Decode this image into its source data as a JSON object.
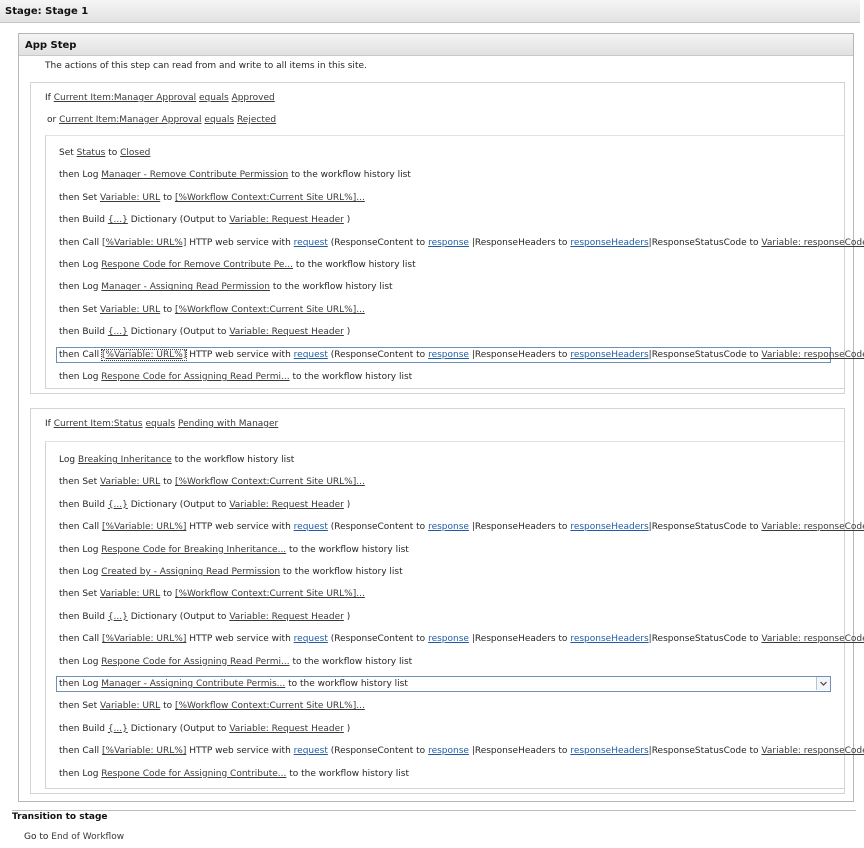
{
  "stage": {
    "title": "Stage: Stage 1"
  },
  "step": {
    "title": "App Step",
    "description": "The actions of this step can read from and write to all items in this site."
  },
  "block1": {
    "conditions": [
      {
        "prefix": "If",
        "field": "Current Item:Manager Approval",
        "op": "equals",
        "value": "Approved"
      },
      {
        "prefix": "or",
        "field": "Current Item:Manager Approval",
        "op": "equals",
        "value": "Rejected"
      }
    ],
    "actions": [
      {
        "prefix": "Set",
        "a": "Status",
        "mid": "to",
        "b": "Closed",
        "suffix": ""
      },
      {
        "prefix": "then Log",
        "a": "Manager - Remove Contribute Permission",
        "mid": "",
        "b": "",
        "suffix": "to the workflow history list"
      },
      {
        "prefix": "then Set",
        "a": "Variable: URL",
        "mid": "to",
        "b": "[%Workflow Context:Current Site URL%]...",
        "suffix": ""
      },
      {
        "prefix": "then Build",
        "a": "{...}",
        "mid": "Dictionary (Output to",
        "b": "Variable: Request Header",
        "suffix": ")"
      },
      {
        "prefix": "then Call",
        "http": true
      },
      {
        "prefix": "then Log",
        "a": "Respone Code for Remove Contribute Pe...",
        "mid": "",
        "b": "",
        "suffix": "to the workflow history list"
      },
      {
        "prefix": "then Log",
        "a": "Manager - Assigning Read Permission",
        "mid": "",
        "b": "",
        "suffix": "to the workflow history list"
      },
      {
        "prefix": "then Set",
        "a": "Variable: URL",
        "mid": "to",
        "b": "[%Workflow Context:Current Site URL%]...",
        "suffix": ""
      },
      {
        "prefix": "then Build",
        "a": "{...}",
        "mid": "Dictionary (Output to",
        "b": "Variable: Request Header",
        "suffix": ")"
      },
      {
        "prefix": "then Call",
        "http": true,
        "selected": true
      },
      {
        "prefix": "then Log",
        "a": "Respone Code for Assigning Read Permi...",
        "mid": "",
        "b": "",
        "suffix": "to the workflow history list"
      }
    ]
  },
  "block2": {
    "conditions": [
      {
        "prefix": "If",
        "field": "Current Item:Status",
        "op": "equals",
        "value": "Pending with Manager"
      }
    ],
    "actions": [
      {
        "prefix": "Log",
        "a": "Breaking Inheritance",
        "mid": "",
        "b": "",
        "suffix": "to the workflow history list"
      },
      {
        "prefix": "then Set",
        "a": "Variable: URL",
        "mid": "to",
        "b": "[%Workflow Context:Current Site URL%]...",
        "suffix": ""
      },
      {
        "prefix": "then Build",
        "a": "{...}",
        "mid": "Dictionary (Output to",
        "b": "Variable: Request Header",
        "suffix": ")"
      },
      {
        "prefix": "then Call",
        "http": true
      },
      {
        "prefix": "then Log",
        "a": "Respone Code for Breaking Inheritance...",
        "mid": "",
        "b": "",
        "suffix": "to the workflow history list"
      },
      {
        "prefix": "then Log",
        "a": "Created by - Assigning Read Permission",
        "mid": "",
        "b": "",
        "suffix": "to the workflow history list"
      },
      {
        "prefix": "then Set",
        "a": "Variable: URL",
        "mid": "to",
        "b": "[%Workflow Context:Current Site URL%]...",
        "suffix": ""
      },
      {
        "prefix": "then Build",
        "a": "{...}",
        "mid": "Dictionary (Output to",
        "b": "Variable: Request Header",
        "suffix": ")"
      },
      {
        "prefix": "then Call",
        "http": true
      },
      {
        "prefix": "then Log",
        "a": "Respone Code for Assigning Read Permi...",
        "mid": "",
        "b": "",
        "suffix": "to the workflow history list"
      },
      {
        "prefix": "then Log",
        "a": "Manager - Assigning Contribute Permis...",
        "mid": "",
        "b": "",
        "suffix": "to the workflow history list",
        "selected": true
      },
      {
        "prefix": "then Set",
        "a": "Variable: URL",
        "mid": "to",
        "b": "[%Workflow Context:Current Site URL%]...",
        "suffix": ""
      },
      {
        "prefix": "then Build",
        "a": "{...}",
        "mid": "Dictionary (Output to",
        "b": "Variable: Request Header",
        "suffix": ")"
      },
      {
        "prefix": "then Call",
        "http": true
      },
      {
        "prefix": "then Log",
        "a": "Respone Code for Assigning Contribute...",
        "mid": "",
        "b": "",
        "suffix": "to the workflow history list"
      }
    ]
  },
  "http": {
    "url": "[%Variable: URL%]",
    "t1": "HTTP web service with",
    "request": "request",
    "t2": "(ResponseContent to",
    "response": "response",
    "t3": "|ResponseHeaders to",
    "headers": "responseHeaders",
    "t4": "|ResponseStatusCode to",
    "code": "Variable: responseCode",
    "t5": ")"
  },
  "transition": {
    "title": "Transition to stage",
    "goto": "Go to",
    "target": "End of Workflow"
  }
}
